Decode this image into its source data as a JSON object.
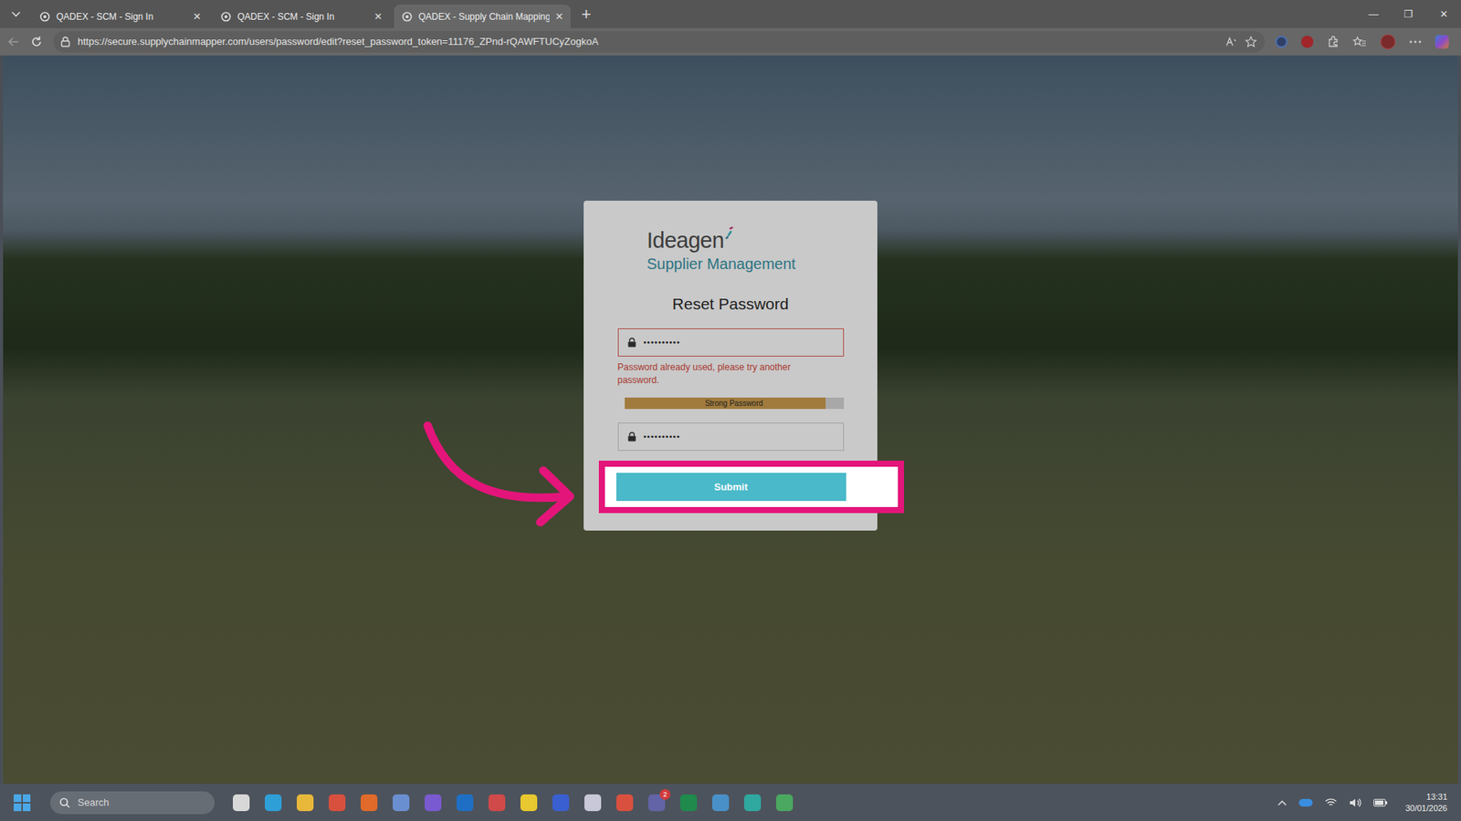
{
  "browser": {
    "tabs": [
      {
        "label": "QADEX - SCM - Sign In",
        "close": "×",
        "selected": false
      },
      {
        "label": "QADEX - SCM - Sign In",
        "close": "×",
        "selected": false
      },
      {
        "label": "QADEX - Supply Chain Mapping",
        "close": "×",
        "selected": true
      }
    ],
    "new_tab": "+",
    "window_controls": [
      "—",
      "❐",
      "✕"
    ],
    "url": "https://secure.supplychainmapper.com/users/password/edit?reset_password_token=11176_ZPnd-rQAWFTUCyZogkoA"
  },
  "page": {
    "logo": {
      "name": "Ideagen",
      "product": "Supplier Management"
    },
    "title": "Reset Password",
    "password": {
      "value": "••••••••••",
      "error": "Password already used, please try another password.",
      "invalid": true
    },
    "strength": {
      "label": "Strong Password",
      "level": 0.92
    },
    "confirm": {
      "value": "••••••••••"
    },
    "submit": "Submit",
    "highlighted": true
  },
  "taskbar": {
    "search": "Search",
    "badge": "2",
    "time": "13:31",
    "date": "30/01/2026"
  }
}
